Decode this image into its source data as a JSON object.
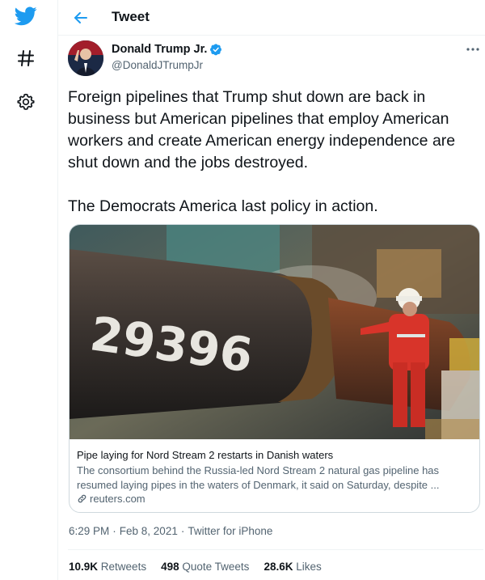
{
  "header": {
    "title": "Tweet"
  },
  "author": {
    "display_name": "Donald Trump Jr.",
    "handle": "@DonaldJTrumpJr"
  },
  "tweet": {
    "text": "Foreign pipelines that Trump shut down are back in business but American pipelines that employ American workers and create American energy independence are shut down and the jobs destroyed.\n\nThe Democrats America last policy in action."
  },
  "card": {
    "image_number": "29396",
    "title": "Pipe laying for Nord Stream 2 restarts in Danish waters",
    "description": "The consortium behind the Russia-led Nord Stream 2 natural gas pipeline has resumed laying pipes in the waters of Denmark, it said on Saturday, despite ...",
    "domain": "reuters.com"
  },
  "meta": {
    "time": "6:29 PM",
    "date": "Feb 8, 2021",
    "source": "Twitter for iPhone"
  },
  "stats": {
    "retweets_count": "10.9K",
    "retweets_label": "Retweets",
    "quotes_count": "498",
    "quotes_label": "Quote Tweets",
    "likes_count": "28.6K",
    "likes_label": "Likes"
  },
  "colors": {
    "accent": "#1d9bf0",
    "text": "#0f1419",
    "secondary": "#536471",
    "border": "#cfd9de"
  },
  "icons": [
    "twitter-logo-icon",
    "hashtag-icon",
    "gear-icon",
    "back-arrow-icon",
    "verified-badge-icon",
    "more-icon",
    "link-icon"
  ]
}
